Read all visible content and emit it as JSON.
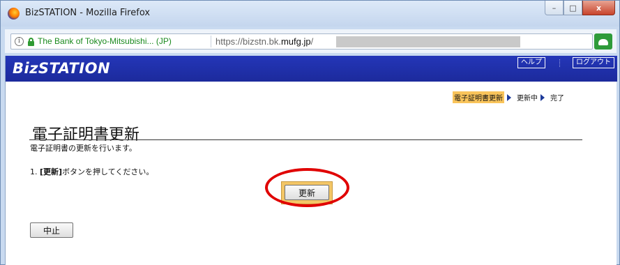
{
  "window": {
    "title": "BizSTATION - Mozilla Firefox",
    "controls": {
      "minimize": "–",
      "maximize": "□",
      "close": "x"
    }
  },
  "addressbar": {
    "info_glyph": "i",
    "site_identity": "The Bank of Tokyo-Mitsubishi... (JP)",
    "url_prefix": "https://bizstn.bk.",
    "url_domain": "mufg.jp",
    "url_suffix": "/"
  },
  "header": {
    "brand": "BizSTATION",
    "help_label": "ヘルプ",
    "logout_label": "ログアウト"
  },
  "steps": [
    {
      "label": "電子証明書更新",
      "current": true
    },
    {
      "label": "更新中",
      "current": false
    },
    {
      "label": "完了",
      "current": false
    }
  ],
  "main": {
    "title": "電子証明書更新",
    "description": "電子証明書の更新を行います。",
    "instruction_prefix": "1. ",
    "instruction_bold": "[更新]",
    "instruction_suffix": "ボタンを押してください。",
    "update_button": "更新",
    "cancel_button": "中止"
  },
  "colors": {
    "header_bg": "#1c2a9c",
    "step_highlight": "#f9c45b",
    "annotation_red": "#e00000",
    "secure_green": "#2f9a33"
  }
}
